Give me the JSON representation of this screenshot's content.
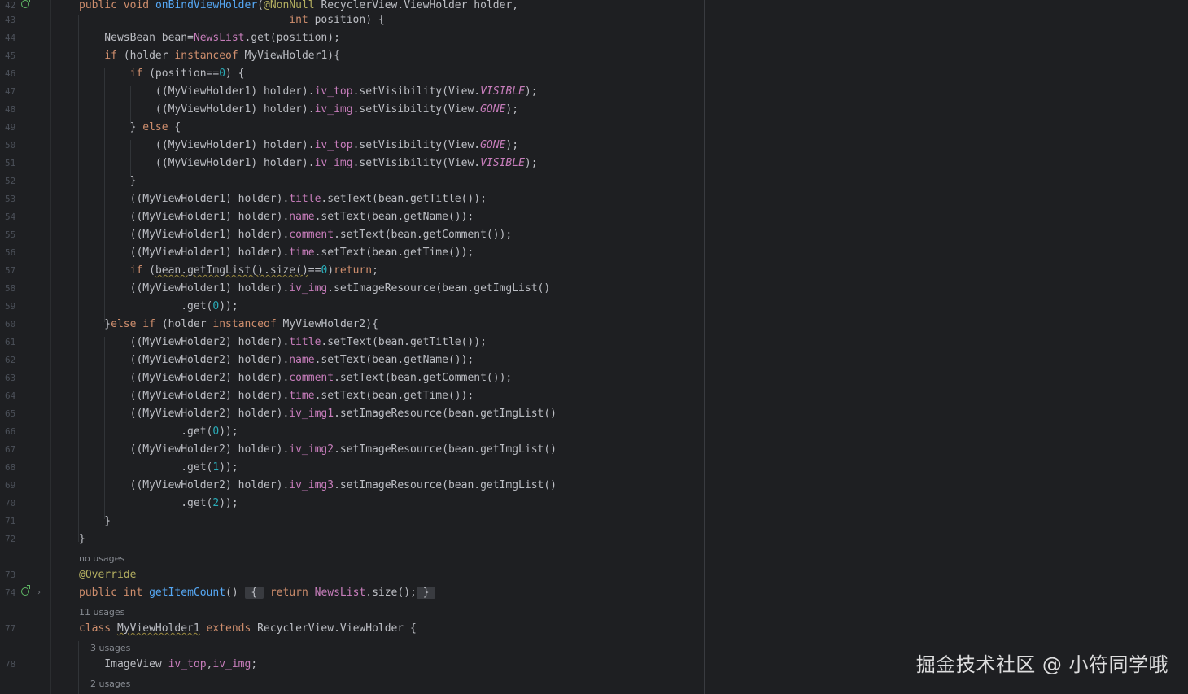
{
  "editor": {
    "lines": [
      {
        "num": "42",
        "text": "public void onBindViewHolder(@NonNull RecyclerView.ViewHolder holder,",
        "icon": true
      },
      {
        "num": "43",
        "text": "                                 int position) {"
      },
      {
        "num": "44",
        "text": "    NewsBean bean=NewsList.get(position);"
      },
      {
        "num": "45",
        "text": "    if (holder instanceof MyViewHolder1){"
      },
      {
        "num": "46",
        "text": "        if (position==0) {"
      },
      {
        "num": "47",
        "text": "            ((MyViewHolder1) holder).iv_top.setVisibility(View.VISIBLE);"
      },
      {
        "num": "48",
        "text": "            ((MyViewHolder1) holder).iv_img.setVisibility(View.GONE);"
      },
      {
        "num": "49",
        "text": "        } else {"
      },
      {
        "num": "50",
        "text": "            ((MyViewHolder1) holder).iv_top.setVisibility(View.GONE);"
      },
      {
        "num": "51",
        "text": "            ((MyViewHolder1) holder).iv_img.setVisibility(View.VISIBLE);"
      },
      {
        "num": "52",
        "text": "        }"
      },
      {
        "num": "53",
        "text": "        ((MyViewHolder1) holder).title.setText(bean.getTitle());"
      },
      {
        "num": "54",
        "text": "        ((MyViewHolder1) holder).name.setText(bean.getName());"
      },
      {
        "num": "55",
        "text": "        ((MyViewHolder1) holder).comment.setText(bean.getComment());"
      },
      {
        "num": "56",
        "text": "        ((MyViewHolder1) holder).time.setText(bean.getTime());"
      },
      {
        "num": "57",
        "text": "        if (bean.getImgList().size()==0)return;"
      },
      {
        "num": "58",
        "text": "        ((MyViewHolder1) holder).iv_img.setImageResource(bean.getImgList()"
      },
      {
        "num": "59",
        "text": "                .get(0));"
      },
      {
        "num": "60",
        "text": "    }else if (holder instanceof MyViewHolder2){"
      },
      {
        "num": "61",
        "text": "        ((MyViewHolder2) holder).title.setText(bean.getTitle());"
      },
      {
        "num": "62",
        "text": "        ((MyViewHolder2) holder).name.setText(bean.getName());"
      },
      {
        "num": "63",
        "text": "        ((MyViewHolder2) holder).comment.setText(bean.getComment());"
      },
      {
        "num": "64",
        "text": "        ((MyViewHolder2) holder).time.setText(bean.getTime());"
      },
      {
        "num": "65",
        "text": "        ((MyViewHolder2) holder).iv_img1.setImageResource(bean.getImgList()"
      },
      {
        "num": "66",
        "text": "                .get(0));"
      },
      {
        "num": "67",
        "text": "        ((MyViewHolder2) holder).iv_img2.setImageResource(bean.getImgList()"
      },
      {
        "num": "68",
        "text": "                .get(1));"
      },
      {
        "num": "69",
        "text": "        ((MyViewHolder2) holder).iv_img3.setImageResource(bean.getImgList()"
      },
      {
        "num": "70",
        "text": "                .get(2));"
      },
      {
        "num": "71",
        "text": "    }"
      },
      {
        "num": "72",
        "text": "}"
      },
      {
        "num": "",
        "hint": "no usages"
      },
      {
        "num": "73",
        "text": "@Override"
      },
      {
        "num": "74",
        "text": "public int getItemCount() { return NewsList.size(); }",
        "icon": true,
        "chevron": true
      },
      {
        "num": "",
        "hint": "11 usages"
      },
      {
        "num": "77",
        "text": "class MyViewHolder1 extends RecyclerView.ViewHolder {"
      },
      {
        "num": "",
        "hint": "    3 usages"
      },
      {
        "num": "78",
        "text": "    ImageView iv_top,iv_img;"
      },
      {
        "num": "",
        "hint": "    2 usages"
      }
    ]
  },
  "watermark": "掘金技术社区 @ 小符同学哦"
}
